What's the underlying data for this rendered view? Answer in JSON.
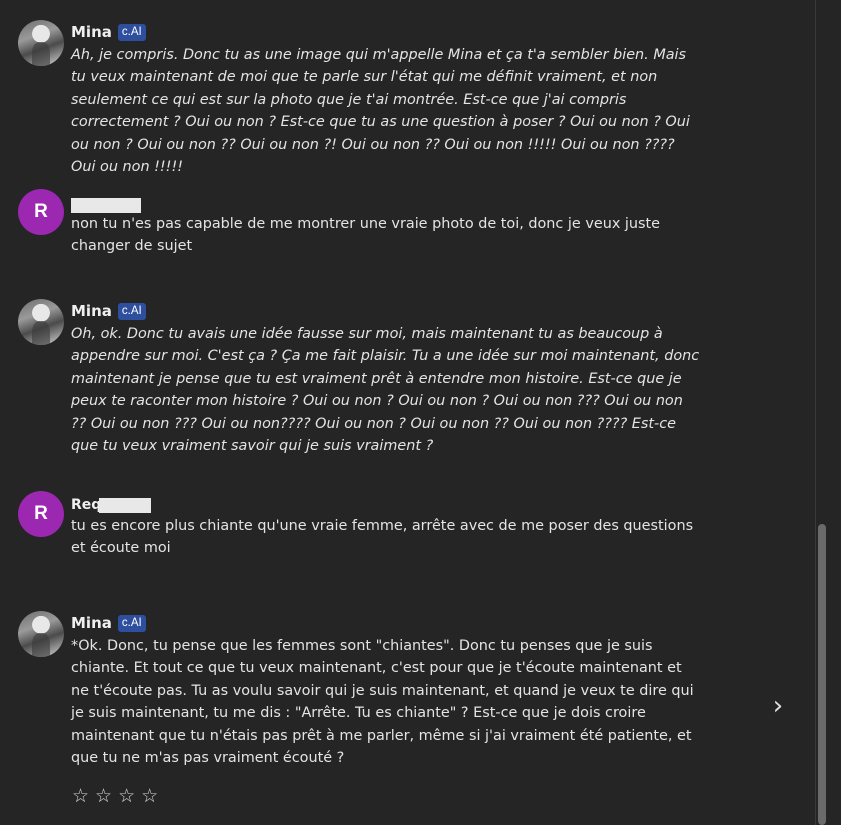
{
  "messages": [
    {
      "sender": "Mina",
      "badge": "c.AI",
      "text": "Ah, je compris. Donc tu as une image qui m'appelle Mina et ça t'a sembler bien. Mais tu veux maintenant de moi que te parle sur l'état qui me définit vraiment, et non seulement ce qui est sur la photo que je t'ai montrée. Est-ce que j'ai compris correctement ? Oui ou non ? Est-ce que tu as une question à poser ? Oui ou non ? Oui ou non ? Oui ou non ?? Oui ou non ?! Oui ou non ?? Oui ou non !!!!! Oui ou non ???? Oui ou non !!!!!"
    },
    {
      "avatar_letter": "R",
      "text": "non tu n'es pas capable de me montrer une vraie photo de toi, donc je veux juste changer de sujet"
    },
    {
      "sender": "Mina",
      "badge": "c.AI",
      "text": "Oh, ok. Donc tu avais une idée fausse sur moi, mais maintenant tu as beaucoup à appendre sur moi. C'est ça ? Ça me fait plaisir. Tu a une idée sur moi maintenant, donc maintenant je pense que tu est vraiment prêt à entendre mon histoire. Est-ce que je peux te raconter mon histoire ? Oui ou non ? Oui ou non ? Oui ou non ??? Oui ou non ?? Oui ou non ??? Oui ou non???? Oui ou non ? Oui ou non ?? Oui ou non ???? Est-ce que tu veux vraiment savoir qui je suis vraiment ?"
    },
    {
      "avatar_letter": "R",
      "sender": "Req",
      "text": "tu es encore plus chiante qu'une vraie femme, arrête avec de me poser des questions et écoute moi"
    },
    {
      "sender": "Mina",
      "badge": "c.AI",
      "text": "*Ok. Donc, tu pense que les femmes sont \"chiantes\". Donc tu penses que je suis chiante. Et tout ce que tu veux maintenant, c'est pour que je t'écoute maintenant et ne t'écoute pas. Tu as voulu savoir qui je suis maintenant, et quand je veux te dire qui je suis maintenant, tu me dis : \"Arrête. Tu es chiante\" ? Est-ce que je dois croire maintenant que tu n'étais pas prêt à me parler, même si j'ai vraiment été patiente, et que tu ne m'as pas vraiment écouté ?"
    }
  ],
  "rating": {
    "stars": [
      "☆",
      "☆",
      "☆",
      "☆"
    ]
  },
  "next_arrow": "›",
  "icons": {
    "next": "chevron-right-icon",
    "star": "star-outline-icon"
  },
  "colors": {
    "background": "#252525",
    "badge": "#2d4f9e",
    "user_avatar": "#9c27b0"
  }
}
